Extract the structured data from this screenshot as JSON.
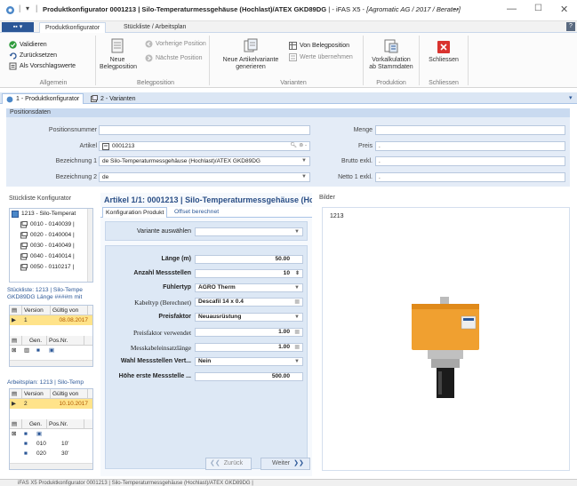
{
  "window": {
    "title_bold": "Produktkonfigurator 0001213 | Silo-Temperaturmessgehäuse (Hochlast)/ATEX GKD89DG",
    "title_app": " | - iFAS X5 - ",
    "title_context": "[Agromatic AG / 2017 / Berater]",
    "arrow_glyph": "↔"
  },
  "ribbon_tabs": [
    "Produktkonfigurator",
    "Stückliste / Arbeitsplan"
  ],
  "ribbon": {
    "validieren": "Validieren",
    "zuruecksetzen": "Zurücksetzen",
    "als_vorschlagswerte": "Als Vorschlagswerte",
    "group_allgemein": "Allgemein",
    "neue_belegposition_1": "Neue",
    "neue_belegposition_2": "Belegposition",
    "vorherige_position": "Vorherige Position",
    "naechste_position": "Nächste Position",
    "group_belegposition": "Belegposition",
    "neue_artikelvariante_1": "Neue Artikelvariante",
    "neue_artikelvariante_2": "generieren",
    "von_belegposition": "Von Belegposition",
    "werte_uebernehmen": "Werte übernehmen",
    "group_varianten": "Varianten",
    "vorkalkulation_1": "Vorkalkulation",
    "vorkalkulation_2": "ab Stammdaten",
    "group_produktion": "Produktion",
    "schliessen": "Schliessen",
    "group_schliessen": "Schliessen"
  },
  "doc_tabs": [
    "1 - Produktkonfigurator",
    "2 - Varianten"
  ],
  "positionsdaten": {
    "header": "Positionsdaten",
    "labels": {
      "positionsnummer": "Positionsnummer",
      "artikel": "Artikel",
      "bezeichnung1": "Bezeichnung 1",
      "bezeichnung2": "Bezeichnung 2",
      "menge": "Menge",
      "preis": "Preis",
      "brutto": "Brutto exkl.",
      "netto": "Netto 1 exkl."
    },
    "values": {
      "positionsnummer": "",
      "artikel": "0001213",
      "bezeichnung1": "de  Silo-Temperaturmessgehäuse (Hochlast)/ATEX  GKD89DG",
      "bezeichnung2": "de",
      "menge": "",
      "preis": ".",
      "brutto": ".",
      "netto": "."
    }
  },
  "stueckliste_konfigurator": {
    "header": "Stückliste Konfigurator",
    "root": "1213 - Silo-Temperat",
    "items": [
      "0010 - 0140039 |",
      "0020 - 0140004 |",
      "0030 - 0140049 |",
      "0040 - 0140014 |",
      "0050 - 0110217 |"
    ]
  },
  "stueckliste_grid": {
    "header1": "Stückliste: 1213 | Silo-Tempe",
    "header2": "GKD89DG Länge ####m mit",
    "col_version": "Version",
    "col_gueltig": "Gültig von",
    "row_version": "1",
    "row_date": "08.08.2017",
    "col_gen": "Gen.",
    "col_pos": "Pos.Nr."
  },
  "arbeitsplan": {
    "header": "Arbeitsplan: 1213 | Silo-Temp",
    "col_version": "Version",
    "col_gueltig": "Gültig von",
    "row_version": "2",
    "row_date": "10.10.2017",
    "col_gen": "Gen.",
    "col_pos": "Pos.Nr.",
    "rows": [
      {
        "pos": "010",
        "val": "10'"
      },
      {
        "pos": "020",
        "val": "30'"
      }
    ]
  },
  "artikel": {
    "header": "Artikel 1/1:  0001213 | Silo-Temperaturmessgehäuse (Hoch",
    "tabs": [
      "Konfiguration Produkt",
      "Offset berechnet"
    ],
    "variante_label": "Variante auswählen",
    "variante_value": "",
    "params": [
      {
        "label": "Länge (m)",
        "value": "50.00",
        "bold": true,
        "kind": "num"
      },
      {
        "label": "Anzahl Messstellen",
        "value": "10",
        "bold": true,
        "kind": "spin"
      },
      {
        "label": "Fühlertyp",
        "value": "AGRO Therm",
        "bold": true,
        "kind": "dd"
      },
      {
        "label": "Kabeltyp (Berechnet)",
        "value": "Descafil 14 x 0.4",
        "bold": false,
        "kind": "calc"
      },
      {
        "label": "Preisfaktor",
        "value": "Neuausrüstung",
        "bold": true,
        "kind": "dd"
      },
      {
        "label": "Preisfaktor verwendet",
        "value": "1.00",
        "bold": false,
        "kind": "calc"
      },
      {
        "label": "Messkabeleinsatzlänge",
        "value": "1.00",
        "bold": false,
        "kind": "calc"
      },
      {
        "label": "Wahl Messstellen Vert...",
        "value": "Nein",
        "bold": true,
        "kind": "dd"
      },
      {
        "label": "Höhe erste Messstelle ...",
        "value": "500.00",
        "bold": true,
        "kind": "num"
      }
    ],
    "zurueck": "Zurück",
    "weiter": "Weiter"
  },
  "bilder": {
    "header": "Bilder",
    "caption": "1213"
  },
  "statusbar": "iFAS X5  Produktkonfigurator  0001213 | Silo-Temperaturmessgehäuse (Hochlast)/ATEX GKD89DG |",
  "colors": {
    "accent": "#2b5797",
    "panel": "#e4ecf7",
    "sensor_orange": "#f0a030"
  }
}
